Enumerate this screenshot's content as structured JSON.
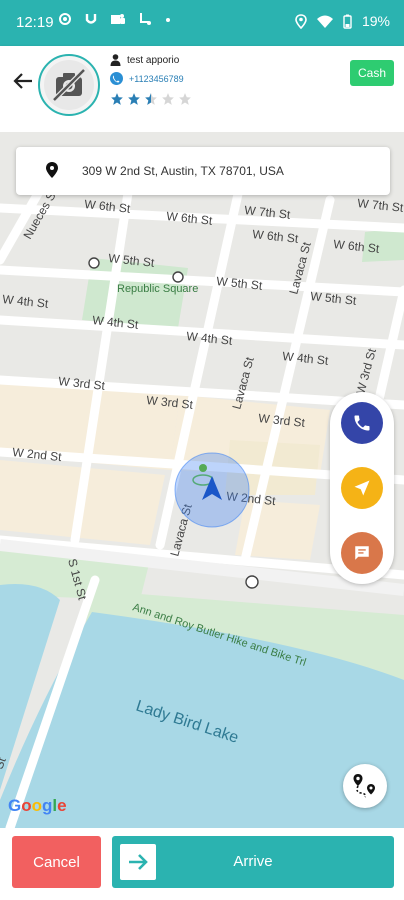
{
  "status_bar": {
    "time": "12:19",
    "battery": "19%",
    "icons": [
      "circle-icon",
      "u-icon",
      "teams-icon",
      "route-icon",
      "dot-icon",
      "location-icon",
      "wifi-icon",
      "battery-icon"
    ]
  },
  "header": {
    "back_icon": "arrow-left-icon",
    "user_name": "test apporio",
    "phone": "+1123456789",
    "rating": {
      "value": 2.5,
      "max": 5
    },
    "payment_label": "Cash",
    "colors": {
      "accent": "#2bb3b0",
      "cash": "#2ecc71",
      "star": "#2a7fb5"
    }
  },
  "address": {
    "text": "309 W 2nd St, Austin, TX 78701, USA"
  },
  "map": {
    "labels": [
      "W 6th St",
      "W 6th St",
      "W 6th St",
      "W 6th St",
      "W 7th St",
      "W 7th St",
      "Nueces St",
      "W 5th St",
      "W 5th St",
      "W 5th St",
      "Republic Square",
      "W 4th St",
      "W 4th St",
      "W 4th St",
      "W 4th St",
      "Lavaca St",
      "W 3rd St",
      "W 3rd St",
      "W 3rd St",
      "W 3rd St",
      "Lavaca St",
      "W 2nd St",
      "W 2nd St",
      "Lavaca St",
      "S 1st St",
      "Ann and Roy Butler Hike and Bike Trl",
      "Lady Bird Lake",
      "St"
    ],
    "attribution": "Google"
  },
  "actions": {
    "call_icon": "phone-icon",
    "navigate_icon": "navigation-icon",
    "chat_icon": "chat-icon",
    "route_icon": "route-map-icon",
    "colors": {
      "call": "#3445a8",
      "navigate": "#f5b316",
      "chat": "#d9774a"
    }
  },
  "bottom": {
    "cancel_label": "Cancel",
    "arrive_label": "Arrive",
    "arrive_icon": "arrow-right-icon",
    "colors": {
      "cancel": "#f26060",
      "arrive": "#2bb3b0"
    }
  }
}
